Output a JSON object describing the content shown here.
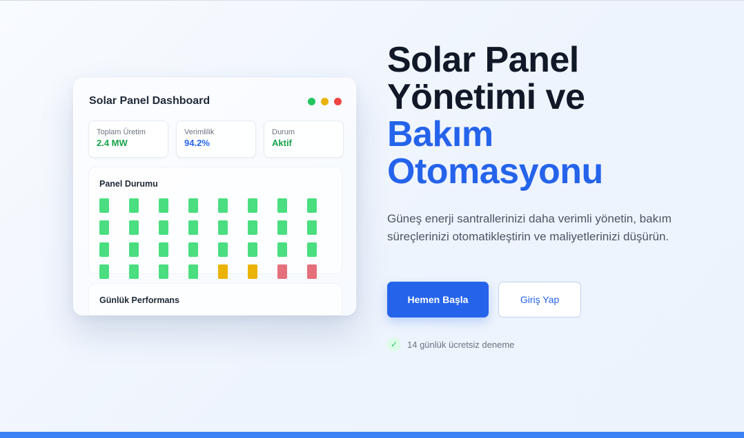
{
  "dashboard": {
    "title": "Solar Panel Dashboard",
    "window_dots": [
      "#22c55e",
      "#eab308",
      "#ef4444"
    ],
    "stats": [
      {
        "label": "Toplam Üretim",
        "value": "2.4 MW",
        "color": "#16a34a"
      },
      {
        "label": "Verimlilik",
        "value": "94.2%",
        "color": "#2563eb"
      },
      {
        "label": "Durum",
        "value": "Aktif",
        "color": "#16a34a"
      }
    ],
    "panel_status": {
      "title": "Panel Durumu",
      "colors": {
        "ok": "#4ade80",
        "warning": "#eab308",
        "error": "#e5707c"
      },
      "rows": [
        [
          "ok",
          "ok",
          "ok",
          "ok",
          "ok",
          "ok",
          "ok",
          "ok"
        ],
        [
          "ok",
          "ok",
          "ok",
          "ok",
          "ok",
          "ok",
          "ok",
          "ok"
        ],
        [
          "ok",
          "ok",
          "ok",
          "ok",
          "ok",
          "ok",
          "ok",
          "ok"
        ],
        [
          "ok",
          "ok",
          "ok",
          "ok",
          "warning",
          "warning",
          "error",
          "error"
        ]
      ]
    },
    "performance": {
      "title": "Günlük Performans"
    }
  },
  "hero": {
    "title_line1": "Solar Panel",
    "title_line2": "Yönetimi ve",
    "title_line3": "Bakım",
    "title_line4": "Otomasyonu",
    "description": "Güneş enerji santrallerinizi daha verimli yönetin, bakım süreçlerinizi otomatikleştirin ve maliyetlerinizi düşürün.",
    "primary_button": "Hemen Başla",
    "secondary_button": "Giriş Yap",
    "trial_icon": "check-icon",
    "trial_text": "14 günlük ücretsiz deneme"
  },
  "accent_color": "#2563eb"
}
